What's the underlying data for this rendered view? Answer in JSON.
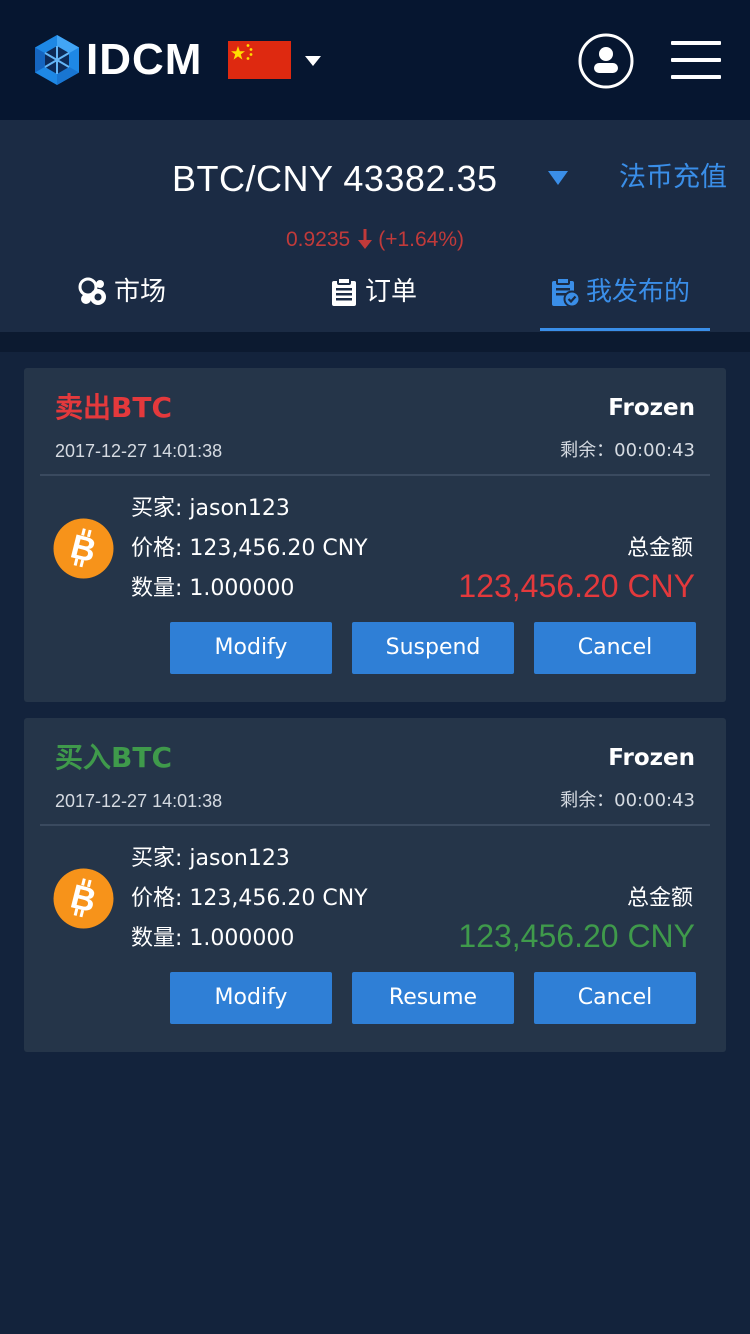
{
  "header": {
    "logo_text": "IDCM",
    "logo_icon": "idcm-hexagon-logo",
    "flag_icon": "china-flag-icon",
    "language_caret_icon": "caret-down-icon",
    "profile_icon": "user-icon",
    "menu_icon": "hamburger-menu-icon"
  },
  "ticker": {
    "pair_price": "BTC/CNY 43382.35",
    "dropdown_icon": "triangle-down-icon",
    "fiat_deposit_label": "法币充值",
    "change_value": "0.9235",
    "change_icon": "arrow-down-icon",
    "change_percent": "(+1.64%)",
    "change_color": "#c13a3a"
  },
  "tabs": [
    {
      "label": "市场",
      "icon": "market-coins-icon",
      "active": false
    },
    {
      "label": "订单",
      "icon": "clipboard-icon",
      "active": false
    },
    {
      "label": "我发布的",
      "icon": "clipboard-check-icon",
      "active": true
    }
  ],
  "accent_color": "#3a8ee8",
  "orders": [
    {
      "side_label": "卖出BTC",
      "side": "sell",
      "status": "Frozen",
      "datetime": "2017-12-27 14:01:38",
      "remaining": "剩余：00:00:43",
      "coin_icon": "bitcoin-icon",
      "buyer": "买家: jason123",
      "price": "价格: 123,456.20 CNY",
      "quantity": "数量: 1.000000",
      "total_label": "总金额",
      "total": "123,456.20 CNY",
      "total_color": "#e4393c",
      "buttons": [
        "Modify",
        "Suspend",
        "Cancel"
      ]
    },
    {
      "side_label": "买入BTC",
      "side": "buy",
      "status": "Frozen",
      "datetime": "2017-12-27 14:01:38",
      "remaining": "剩余：00:00:43",
      "coin_icon": "bitcoin-icon",
      "buyer": "买家: jason123",
      "price": "价格: 123,456.20 CNY",
      "quantity": "数量: 1.000000",
      "total_label": "总金额",
      "total": "123,456.20 CNY",
      "total_color": "#3f9a4b",
      "buttons": [
        "Modify",
        "Resume",
        "Cancel"
      ]
    }
  ]
}
